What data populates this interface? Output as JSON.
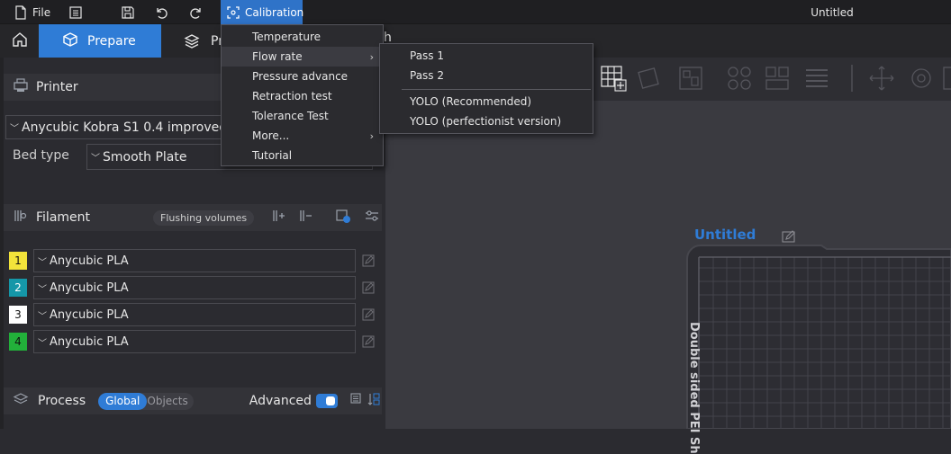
{
  "topbar": {
    "file_label": "File",
    "calibration_label": "Calibration",
    "title": "Untitled",
    "icons": [
      "file-icon",
      "notes-icon",
      "save-icon",
      "undo-icon",
      "redo-icon",
      "calibration-icon"
    ]
  },
  "tabs": {
    "prepare_label": "Prepare",
    "preview_label": "Pr",
    "tail_text": "h"
  },
  "sidebar": {
    "printer": {
      "title": "Printer",
      "printer_value": "Anycubic Kobra S1 0.4 improved",
      "bed_label": "Bed type",
      "bed_value": "Smooth Plate"
    },
    "filament": {
      "title": "Filament",
      "flushing_label": "Flushing volumes",
      "items": [
        {
          "num": "1",
          "name": "Anycubic PLA",
          "color": "#f2e33a"
        },
        {
          "num": "2",
          "name": "Anycubic PLA",
          "color": "#1597a8"
        },
        {
          "num": "3",
          "name": "Anycubic PLA",
          "color": "#ffffff"
        },
        {
          "num": "4",
          "name": "Anycubic PLA",
          "color": "#22b03a"
        }
      ]
    },
    "process": {
      "title": "Process",
      "global_label": "Global",
      "objects_label": "Objects",
      "advanced_label": "Advanced"
    }
  },
  "calibration_menu": {
    "items": [
      "Temperature",
      "Flow rate",
      "Pressure advance",
      "Retraction test",
      "Tolerance Test",
      "More...",
      "Tutorial"
    ],
    "arrow": "›"
  },
  "flow_rate_submenu": {
    "items": [
      "Pass 1",
      "Pass 2",
      "YOLO (Recommended)",
      "YOLO (perfectionist version)"
    ]
  },
  "viewport": {
    "plate_name": "Untitled",
    "bed_label": "Double sided PEI Sh"
  },
  "colors": {
    "accent": "#2f7cd6",
    "menu_bg": "#2b2b2f",
    "panel_bg": "#2b2b30"
  }
}
